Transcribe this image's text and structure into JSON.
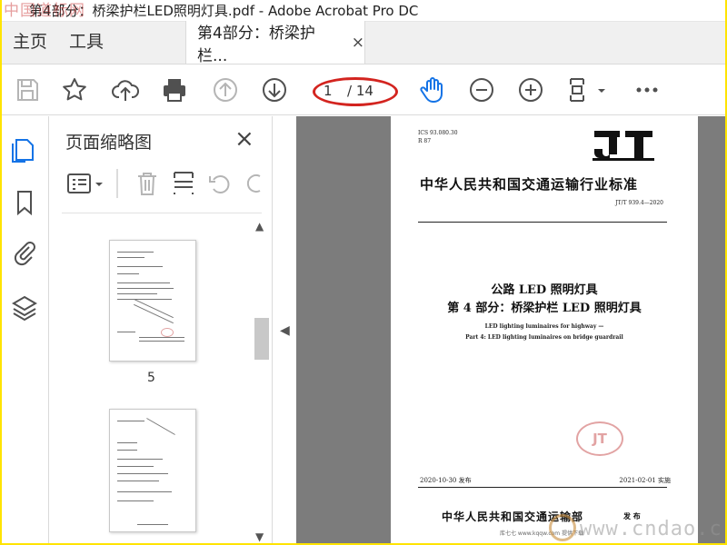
{
  "window": {
    "title": "第4部分：桥梁护栏LED照明灯具.pdf - Adobe Acrobat Pro DC",
    "watermark_tl": "中国道标网"
  },
  "menubar": {
    "home": "主页",
    "tools": "工具",
    "tab_label": "第4部分：桥梁护栏...",
    "tab_close": "×"
  },
  "toolbar": {
    "current_page": "1",
    "total_pages": "/ 14",
    "icons": [
      "save-icon",
      "star-icon",
      "upload-cloud-icon",
      "print-icon",
      "up-page-icon",
      "down-page-icon",
      "hand-tool-icon",
      "zoom-out-icon",
      "zoom-in-icon",
      "fit-page-icon",
      "more-icon"
    ]
  },
  "panel": {
    "title": "页面缩略图",
    "close": "×",
    "thumbs": [
      {
        "label": "5"
      },
      {
        "label": ""
      }
    ]
  },
  "document": {
    "ics": "ICS 93.080.30",
    "ccs": "R 87",
    "logo": "JT",
    "standard_name": "中华人民共和国交通运输行业标准",
    "code": "JT/T 939.4—2020",
    "title_cn_1": "公路 LED 照明灯具",
    "title_cn_2": "第 4 部分：桥梁护栏 LED 照明灯具",
    "title_en_1": "LED lighting luminaires for highway —",
    "title_en_2": "Part 4: LED lighting luminaires on bridge guardrail",
    "stamp": "JT",
    "issue_date": "2020-10-30 发布",
    "impl_date": "2021-02-01 实施",
    "publisher": "中华人民共和国交通运输部",
    "publish_word": "发 布",
    "footer": "库七七 www.kqqw.com 提供下载",
    "watermark_br": "www.cndao.c"
  },
  "colors": {
    "accent": "#d3241f",
    "hand_tool": "#1473e6",
    "bg_doc": "#7c7c7c",
    "frame": "#ffe400"
  }
}
